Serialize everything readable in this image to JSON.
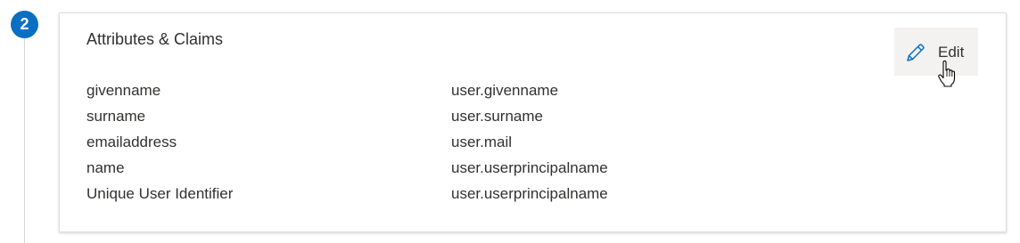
{
  "step": {
    "number": "2",
    "accent_color": "#0a6fc2"
  },
  "card": {
    "title": "Attributes & Claims",
    "edit_label": "Edit",
    "edit_icon": "pencil-icon",
    "cursor_icon": "hand-pointer-icon",
    "rows": [
      {
        "name": "givenname",
        "value": "user.givenname"
      },
      {
        "name": "surname",
        "value": "user.surname"
      },
      {
        "name": "emailaddress",
        "value": "user.mail"
      },
      {
        "name": "name",
        "value": "user.userprincipalname"
      },
      {
        "name": "Unique User Identifier",
        "value": "user.userprincipalname"
      }
    ]
  }
}
